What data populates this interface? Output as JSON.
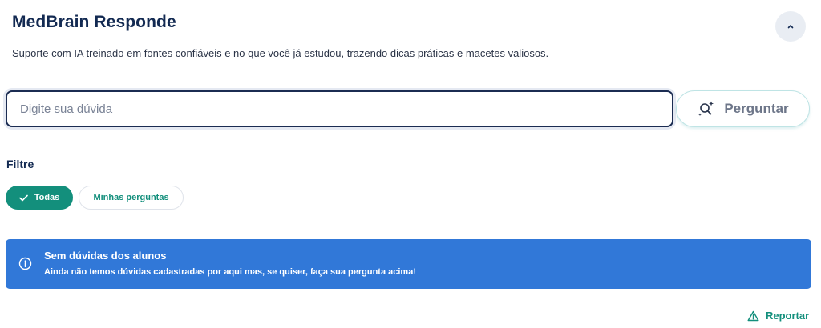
{
  "header": {
    "title": "MedBrain Responde",
    "subtitle": "Suporte com IA treinado em fontes confiáveis e no que você já estudou, trazendo dicas práticas e macetes valiosos.",
    "collapse_icon": "chevron-up-icon"
  },
  "search": {
    "placeholder": "Digite sua dúvida",
    "value": "",
    "button_label": "Perguntar",
    "button_icon": "ai-search-sparkle-icon"
  },
  "filters": {
    "label": "Filtre",
    "options": [
      {
        "label": "Todas",
        "selected": true,
        "icon": "check-icon"
      },
      {
        "label": "Minhas perguntas",
        "selected": false
      }
    ]
  },
  "alert": {
    "icon": "info-icon",
    "title": "Sem dúvidas dos alunos",
    "message": "Ainda não temos dúvidas cadastradas por aqui mas, se quiser, faça sua pergunta acima!"
  },
  "report": {
    "label": "Reportar",
    "icon": "warning-triangle-icon"
  },
  "colors": {
    "title": "#132a52",
    "accent_green": "#138f7c",
    "alert_blue": "#3178d8",
    "input_border": "#1b2c52"
  }
}
